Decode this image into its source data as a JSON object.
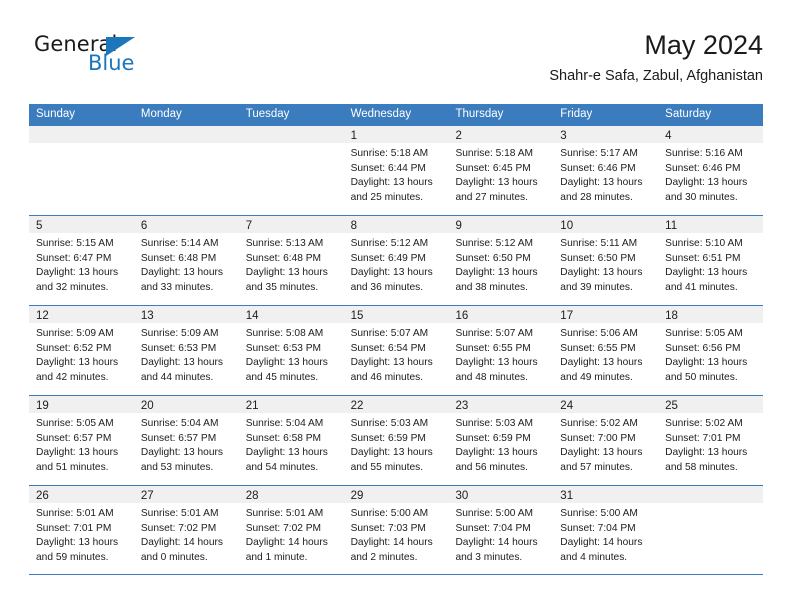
{
  "brand": {
    "name_part1": "General",
    "name_part2": "Blue",
    "logo_icon": "triangle-icon"
  },
  "header": {
    "title": "May 2024",
    "subtitle": "Shahr-e Safa, Zabul, Afghanistan"
  },
  "colors": {
    "header_blue": "#3a7cbe",
    "brand_blue": "#1b76bc",
    "daynum_band": "#f0f0f0",
    "text": "#202020"
  },
  "calendar": {
    "weekday_headers": [
      "Sunday",
      "Monday",
      "Tuesday",
      "Wednesday",
      "Thursday",
      "Friday",
      "Saturday"
    ],
    "weeks": [
      [
        {
          "day": "",
          "empty": true,
          "sunrise": "",
          "sunset": "",
          "daylight1": "",
          "daylight2": ""
        },
        {
          "day": "",
          "empty": true,
          "sunrise": "",
          "sunset": "",
          "daylight1": "",
          "daylight2": ""
        },
        {
          "day": "",
          "empty": true,
          "sunrise": "",
          "sunset": "",
          "daylight1": "",
          "daylight2": ""
        },
        {
          "day": "1",
          "empty": false,
          "sunrise": "Sunrise: 5:18 AM",
          "sunset": "Sunset: 6:44 PM",
          "daylight1": "Daylight: 13 hours",
          "daylight2": "and 25 minutes."
        },
        {
          "day": "2",
          "empty": false,
          "sunrise": "Sunrise: 5:18 AM",
          "sunset": "Sunset: 6:45 PM",
          "daylight1": "Daylight: 13 hours",
          "daylight2": "and 27 minutes."
        },
        {
          "day": "3",
          "empty": false,
          "sunrise": "Sunrise: 5:17 AM",
          "sunset": "Sunset: 6:46 PM",
          "daylight1": "Daylight: 13 hours",
          "daylight2": "and 28 minutes."
        },
        {
          "day": "4",
          "empty": false,
          "sunrise": "Sunrise: 5:16 AM",
          "sunset": "Sunset: 6:46 PM",
          "daylight1": "Daylight: 13 hours",
          "daylight2": "and 30 minutes."
        }
      ],
      [
        {
          "day": "5",
          "empty": false,
          "sunrise": "Sunrise: 5:15 AM",
          "sunset": "Sunset: 6:47 PM",
          "daylight1": "Daylight: 13 hours",
          "daylight2": "and 32 minutes."
        },
        {
          "day": "6",
          "empty": false,
          "sunrise": "Sunrise: 5:14 AM",
          "sunset": "Sunset: 6:48 PM",
          "daylight1": "Daylight: 13 hours",
          "daylight2": "and 33 minutes."
        },
        {
          "day": "7",
          "empty": false,
          "sunrise": "Sunrise: 5:13 AM",
          "sunset": "Sunset: 6:48 PM",
          "daylight1": "Daylight: 13 hours",
          "daylight2": "and 35 minutes."
        },
        {
          "day": "8",
          "empty": false,
          "sunrise": "Sunrise: 5:12 AM",
          "sunset": "Sunset: 6:49 PM",
          "daylight1": "Daylight: 13 hours",
          "daylight2": "and 36 minutes."
        },
        {
          "day": "9",
          "empty": false,
          "sunrise": "Sunrise: 5:12 AM",
          "sunset": "Sunset: 6:50 PM",
          "daylight1": "Daylight: 13 hours",
          "daylight2": "and 38 minutes."
        },
        {
          "day": "10",
          "empty": false,
          "sunrise": "Sunrise: 5:11 AM",
          "sunset": "Sunset: 6:50 PM",
          "daylight1": "Daylight: 13 hours",
          "daylight2": "and 39 minutes."
        },
        {
          "day": "11",
          "empty": false,
          "sunrise": "Sunrise: 5:10 AM",
          "sunset": "Sunset: 6:51 PM",
          "daylight1": "Daylight: 13 hours",
          "daylight2": "and 41 minutes."
        }
      ],
      [
        {
          "day": "12",
          "empty": false,
          "sunrise": "Sunrise: 5:09 AM",
          "sunset": "Sunset: 6:52 PM",
          "daylight1": "Daylight: 13 hours",
          "daylight2": "and 42 minutes."
        },
        {
          "day": "13",
          "empty": false,
          "sunrise": "Sunrise: 5:09 AM",
          "sunset": "Sunset: 6:53 PM",
          "daylight1": "Daylight: 13 hours",
          "daylight2": "and 44 minutes."
        },
        {
          "day": "14",
          "empty": false,
          "sunrise": "Sunrise: 5:08 AM",
          "sunset": "Sunset: 6:53 PM",
          "daylight1": "Daylight: 13 hours",
          "daylight2": "and 45 minutes."
        },
        {
          "day": "15",
          "empty": false,
          "sunrise": "Sunrise: 5:07 AM",
          "sunset": "Sunset: 6:54 PM",
          "daylight1": "Daylight: 13 hours",
          "daylight2": "and 46 minutes."
        },
        {
          "day": "16",
          "empty": false,
          "sunrise": "Sunrise: 5:07 AM",
          "sunset": "Sunset: 6:55 PM",
          "daylight1": "Daylight: 13 hours",
          "daylight2": "and 48 minutes."
        },
        {
          "day": "17",
          "empty": false,
          "sunrise": "Sunrise: 5:06 AM",
          "sunset": "Sunset: 6:55 PM",
          "daylight1": "Daylight: 13 hours",
          "daylight2": "and 49 minutes."
        },
        {
          "day": "18",
          "empty": false,
          "sunrise": "Sunrise: 5:05 AM",
          "sunset": "Sunset: 6:56 PM",
          "daylight1": "Daylight: 13 hours",
          "daylight2": "and 50 minutes."
        }
      ],
      [
        {
          "day": "19",
          "empty": false,
          "sunrise": "Sunrise: 5:05 AM",
          "sunset": "Sunset: 6:57 PM",
          "daylight1": "Daylight: 13 hours",
          "daylight2": "and 51 minutes."
        },
        {
          "day": "20",
          "empty": false,
          "sunrise": "Sunrise: 5:04 AM",
          "sunset": "Sunset: 6:57 PM",
          "daylight1": "Daylight: 13 hours",
          "daylight2": "and 53 minutes."
        },
        {
          "day": "21",
          "empty": false,
          "sunrise": "Sunrise: 5:04 AM",
          "sunset": "Sunset: 6:58 PM",
          "daylight1": "Daylight: 13 hours",
          "daylight2": "and 54 minutes."
        },
        {
          "day": "22",
          "empty": false,
          "sunrise": "Sunrise: 5:03 AM",
          "sunset": "Sunset: 6:59 PM",
          "daylight1": "Daylight: 13 hours",
          "daylight2": "and 55 minutes."
        },
        {
          "day": "23",
          "empty": false,
          "sunrise": "Sunrise: 5:03 AM",
          "sunset": "Sunset: 6:59 PM",
          "daylight1": "Daylight: 13 hours",
          "daylight2": "and 56 minutes."
        },
        {
          "day": "24",
          "empty": false,
          "sunrise": "Sunrise: 5:02 AM",
          "sunset": "Sunset: 7:00 PM",
          "daylight1": "Daylight: 13 hours",
          "daylight2": "and 57 minutes."
        },
        {
          "day": "25",
          "empty": false,
          "sunrise": "Sunrise: 5:02 AM",
          "sunset": "Sunset: 7:01 PM",
          "daylight1": "Daylight: 13 hours",
          "daylight2": "and 58 minutes."
        }
      ],
      [
        {
          "day": "26",
          "empty": false,
          "sunrise": "Sunrise: 5:01 AM",
          "sunset": "Sunset: 7:01 PM",
          "daylight1": "Daylight: 13 hours",
          "daylight2": "and 59 minutes."
        },
        {
          "day": "27",
          "empty": false,
          "sunrise": "Sunrise: 5:01 AM",
          "sunset": "Sunset: 7:02 PM",
          "daylight1": "Daylight: 14 hours",
          "daylight2": "and 0 minutes."
        },
        {
          "day": "28",
          "empty": false,
          "sunrise": "Sunrise: 5:01 AM",
          "sunset": "Sunset: 7:02 PM",
          "daylight1": "Daylight: 14 hours",
          "daylight2": "and 1 minute."
        },
        {
          "day": "29",
          "empty": false,
          "sunrise": "Sunrise: 5:00 AM",
          "sunset": "Sunset: 7:03 PM",
          "daylight1": "Daylight: 14 hours",
          "daylight2": "and 2 minutes."
        },
        {
          "day": "30",
          "empty": false,
          "sunrise": "Sunrise: 5:00 AM",
          "sunset": "Sunset: 7:04 PM",
          "daylight1": "Daylight: 14 hours",
          "daylight2": "and 3 minutes."
        },
        {
          "day": "31",
          "empty": false,
          "sunrise": "Sunrise: 5:00 AM",
          "sunset": "Sunset: 7:04 PM",
          "daylight1": "Daylight: 14 hours",
          "daylight2": "and 4 minutes."
        },
        {
          "day": "",
          "empty": true,
          "sunrise": "",
          "sunset": "",
          "daylight1": "",
          "daylight2": ""
        }
      ]
    ]
  }
}
